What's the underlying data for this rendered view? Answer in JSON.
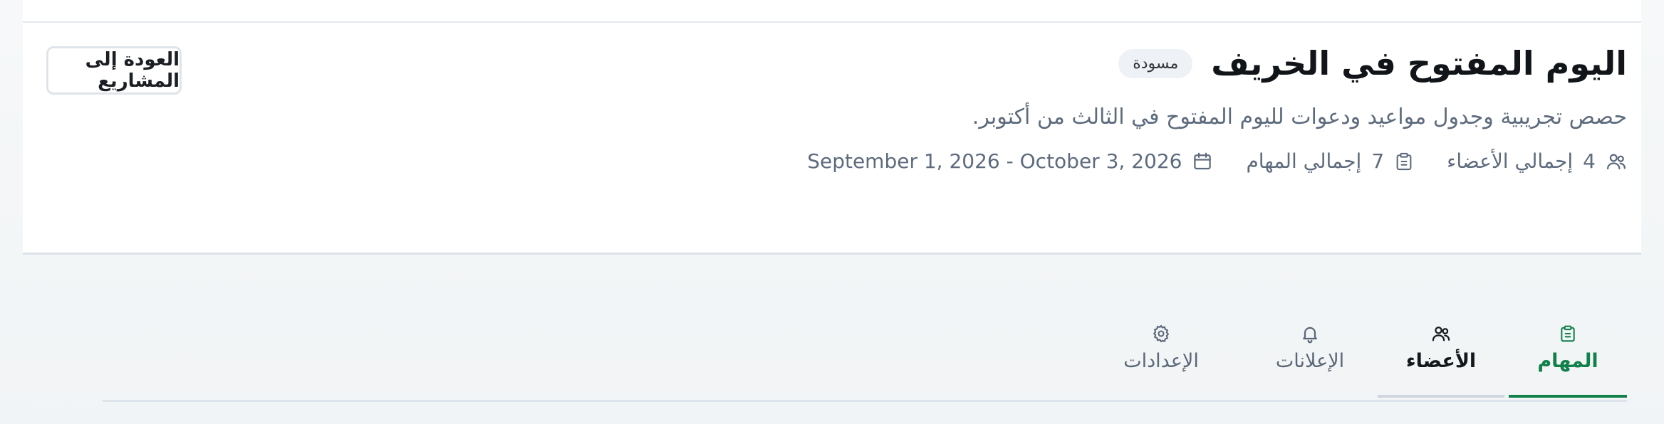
{
  "project": {
    "title": "اليوم المفتوح في الخريف",
    "status_badge": "مسودة",
    "description": "حصص تجريبية وجدول مواعيد ودعوات لليوم المفتوح في الثالث من أكتوبر.",
    "back_button_label": "العودة إلى المشاريع"
  },
  "meta": {
    "members": {
      "count": "4",
      "label": "إجمالي الأعضاء",
      "icon": "users-icon"
    },
    "tasks": {
      "count": "7",
      "label": "إجمالي المهام",
      "icon": "clipboard-icon"
    },
    "dates": {
      "range": "September 1, 2026 - October 3, 2026",
      "icon": "calendar-icon"
    }
  },
  "tabs": [
    {
      "label": "المهام",
      "icon": "clipboard-icon",
      "active": true
    },
    {
      "label": "الأعضاء",
      "icon": "users-icon",
      "active": false
    },
    {
      "label": "الإعلانات",
      "icon": "bell-icon",
      "active": false
    },
    {
      "label": "الإعدادات",
      "icon": "gear-icon",
      "active": false
    }
  ],
  "colors": {
    "accent": "#12804a",
    "muted_text": "#5d6b7d",
    "title_text": "#11151a",
    "border": "#dde3ea"
  }
}
